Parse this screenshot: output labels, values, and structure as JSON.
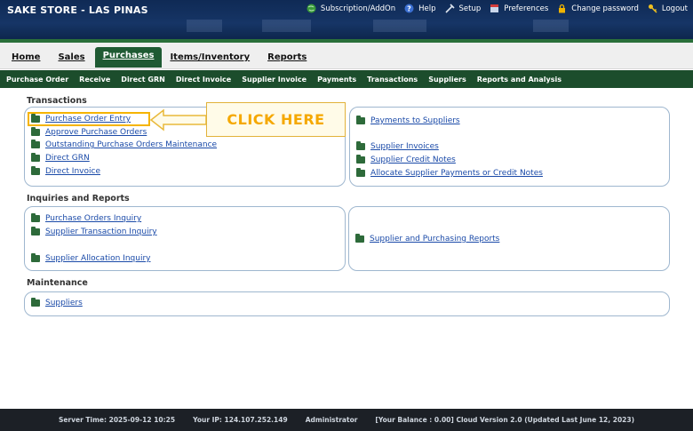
{
  "app": {
    "title": "SAKE STORE - LAS PINAS"
  },
  "toplinks": [
    {
      "label": "Subscription/AddOn",
      "icon": "globe-icon"
    },
    {
      "label": "Help",
      "icon": "help-icon"
    },
    {
      "label": "Setup",
      "icon": "tools-icon"
    },
    {
      "label": "Preferences",
      "icon": "preferences-icon"
    },
    {
      "label": "Change password",
      "icon": "lock-icon"
    },
    {
      "label": "Logout",
      "icon": "key-icon"
    }
  ],
  "tabs": [
    "Home",
    "Sales",
    "Purchases",
    "Items/Inventory",
    "Reports"
  ],
  "active_tab": "Purchases",
  "submenu": [
    "Purchase Order",
    "Receive",
    "Direct GRN",
    "Direct Invoice",
    "Supplier Invoice",
    "Payments",
    "Transactions",
    "Suppliers",
    "Reports and Analysis"
  ],
  "sections": {
    "transactions": {
      "title": "Transactions",
      "left": [
        "Purchase Order Entry",
        "Approve Purchase Orders",
        "Outstanding Purchase Orders Maintenance",
        "Direct GRN",
        "Direct Invoice"
      ],
      "right": [
        "Payments to Suppliers",
        "Supplier Invoices",
        "Supplier Credit Notes",
        "Allocate Supplier Payments or Credit Notes"
      ]
    },
    "inquiries": {
      "title": "Inquiries and Reports",
      "left": [
        "Purchase Orders Inquiry",
        "Supplier Transaction Inquiry",
        "Supplier Allocation Inquiry"
      ],
      "right": [
        "Supplier and Purchasing Reports"
      ]
    },
    "maintenance": {
      "title": "Maintenance",
      "left": [
        "Suppliers"
      ]
    }
  },
  "callout": {
    "text": "CLICK HERE"
  },
  "footer": {
    "server_time": "Server Time: 2025-09-12 10:25",
    "ip": "Your IP: 124.107.252.149",
    "user": "Administrator",
    "balance": "[Your Balance : 0.00] Cloud Version 2.0 (Updated Last June 12, 2023)"
  },
  "colors": {
    "header": "#163566",
    "tab_active": "#1f5a33",
    "submenu": "#1c4d2c",
    "link": "#1a4aa8",
    "callout": "#f5a800",
    "footer": "#1c2026"
  }
}
